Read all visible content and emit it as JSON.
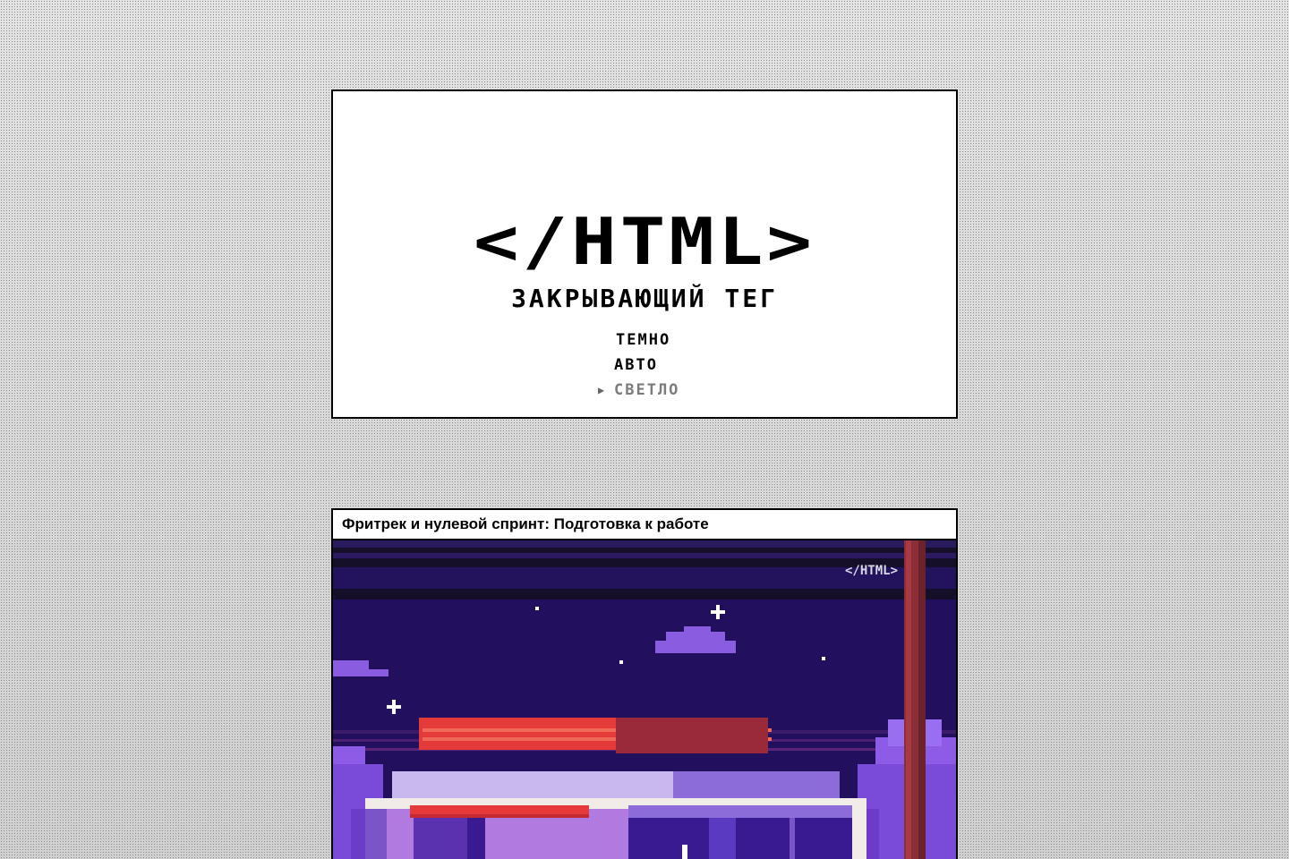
{
  "site": {
    "logo_text": "</HTML>",
    "subtitle": "ЗАКРЫВАЮЩИЙ ТЕГ"
  },
  "theme_switcher": {
    "options": [
      {
        "label": "ТЕМНО",
        "selected": false
      },
      {
        "label": "АВТО",
        "selected": false
      },
      {
        "label": "СВЕТЛО",
        "selected": true
      }
    ],
    "pointer_symbol": "▶"
  },
  "article": {
    "title": "Фритрек и нулевой спринт: Подготовка к работе",
    "image_watermark": "</HTML>"
  },
  "colors": {
    "night_sky": "#22105e",
    "sky_stripe": "#150f2a",
    "van_roof_red": "#e53a3a",
    "van_body": "#f2ece8",
    "van_purple": "#7a55c8",
    "pole": "#8a2e38",
    "tree": "#8d5ce6"
  }
}
